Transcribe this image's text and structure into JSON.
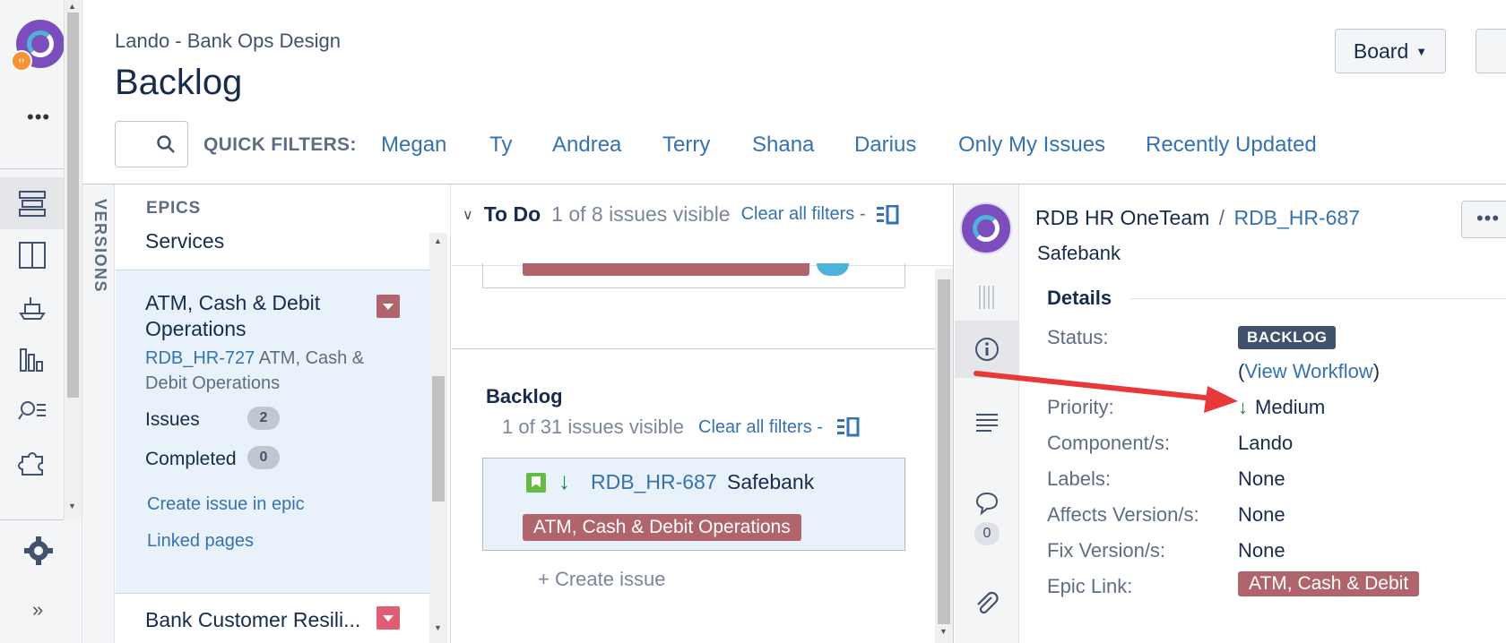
{
  "header": {
    "breadcrumb": "Lando - Bank Ops Design",
    "title": "Backlog",
    "board_label": "Board"
  },
  "quick_filters": {
    "label": "QUICK FILTERS:",
    "items": [
      "Megan",
      "Ty",
      "Andrea",
      "Terry",
      "Shana",
      "Darius",
      "Only My Issues",
      "Recently Updated"
    ]
  },
  "versions_label": "VERSIONS",
  "epics": {
    "heading": "EPICS",
    "items": [
      {
        "name": "Services"
      },
      {
        "name": "ATM, Cash & Debit Operations",
        "key": "RDB_HR-727",
        "key_desc": "ATM, Cash & Debit Operations",
        "issues_label": "Issues",
        "issues_count": "2",
        "completed_label": "Completed",
        "completed_count": "0",
        "create_link": "Create issue in epic",
        "linked_link": "Linked pages",
        "color": "#b0646c"
      },
      {
        "name": "Bank Customer Resili...",
        "color": "#e05d74"
      }
    ]
  },
  "todo": {
    "title": "To Do",
    "visible": "1 of 8 issues visible",
    "clear": "Clear all filters -"
  },
  "backlog": {
    "title": "Backlog",
    "visible": "1 of 31 issues visible",
    "clear": "Clear all filters -",
    "issue": {
      "key": "RDB_HR-687",
      "summary": "Safebank",
      "epic": "ATM, Cash & Debit Operations",
      "type_icon": "story-icon",
      "priority_icon": "arrow-down-icon"
    },
    "create": "+   Create issue"
  },
  "detail": {
    "project": "RDB HR OneTeam",
    "separator": "/",
    "key": "RDB_HR-687",
    "summary": "Safebank",
    "more": "•••",
    "comment_count": "0",
    "section": "Details",
    "fields": {
      "status_label": "Status:",
      "status_value": "BACKLOG",
      "view_workflow": "View Workflow",
      "priority_label": "Priority:",
      "priority_value": "Medium",
      "component_label": "Component/s:",
      "component_value": "Lando",
      "labels_label": "Labels:",
      "labels_value": "None",
      "affects_label": "Affects Version/s:",
      "affects_value": "None",
      "fix_label": "Fix Version/s:",
      "fix_value": "None",
      "epic_label": "Epic Link:",
      "epic_value": "ATM, Cash & Debit"
    }
  },
  "colors": {
    "link": "#3572b0",
    "epic": "#b0646c",
    "status": "#42526e",
    "annotation": "#e8393a"
  }
}
